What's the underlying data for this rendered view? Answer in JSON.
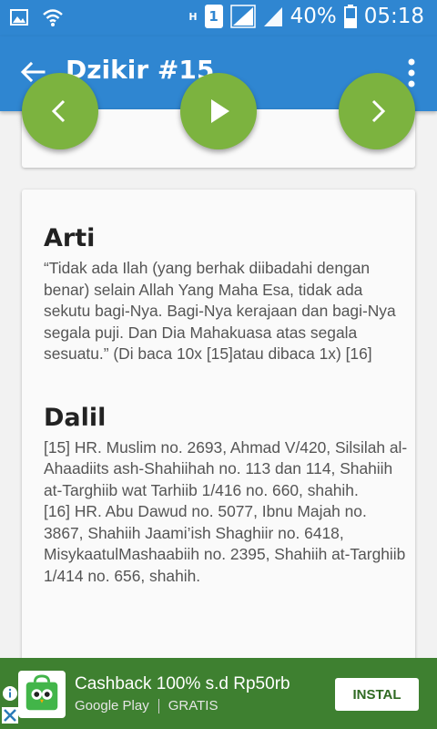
{
  "status_bar": {
    "battery_percent": "40%",
    "time": "05:18",
    "network_label": "H",
    "sim_number": "1",
    "icons": [
      "image-icon",
      "wifi-icon",
      "signal-icon",
      "battery-icon"
    ]
  },
  "toolbar": {
    "title": "Dzikir #15",
    "back_icon": "arrow-back-icon",
    "menu_icon": "more-vertical-icon"
  },
  "player": {
    "prev_icon": "chevron-left-icon",
    "play_icon": "play-icon",
    "next_icon": "chevron-right-icon",
    "accent_color": "#7cb33f"
  },
  "content": {
    "arti_heading": "Arti",
    "arti_text": "“Tidak ada Ilah (yang berhak diibadahi dengan benar) selain Allah Yang Maha Esa, tidak ada sekutu bagi-Nya. Bagi-Nya kerajaan dan bagi-Nya segala puji. Dan Dia Mahakuasa atas segala sesuatu.” (Di baca 10x [15]atau dibaca 1x) [16]",
    "dalil_heading": "Dalil",
    "dalil_line1": "[15] HR. Muslim no. 2693, Ahmad V/420, Silsilah al-Ahaadiits ash-Shahiihah no. 113 dan 114, Shahiih at-Targhiib wat Tarhiib 1/416 no. 660, shahih.",
    "dalil_line2": "[16] HR. Abu Dawud no. 5077, Ibnu Majah no. 3867, Shahiih Jaami’ish Shaghiir no. 6418, MisykaatulMashaabiih no. 2395, Shahiih at-Targhiib 1/414 no. 656, shahih."
  },
  "ad": {
    "headline": "Cashback 100% s.d Rp50rb",
    "store": "Google Play",
    "price": "GRATIS",
    "install_label": "INSTAL",
    "background_color": "#3e8030"
  },
  "colors": {
    "app_bar": "#2f86d1"
  }
}
